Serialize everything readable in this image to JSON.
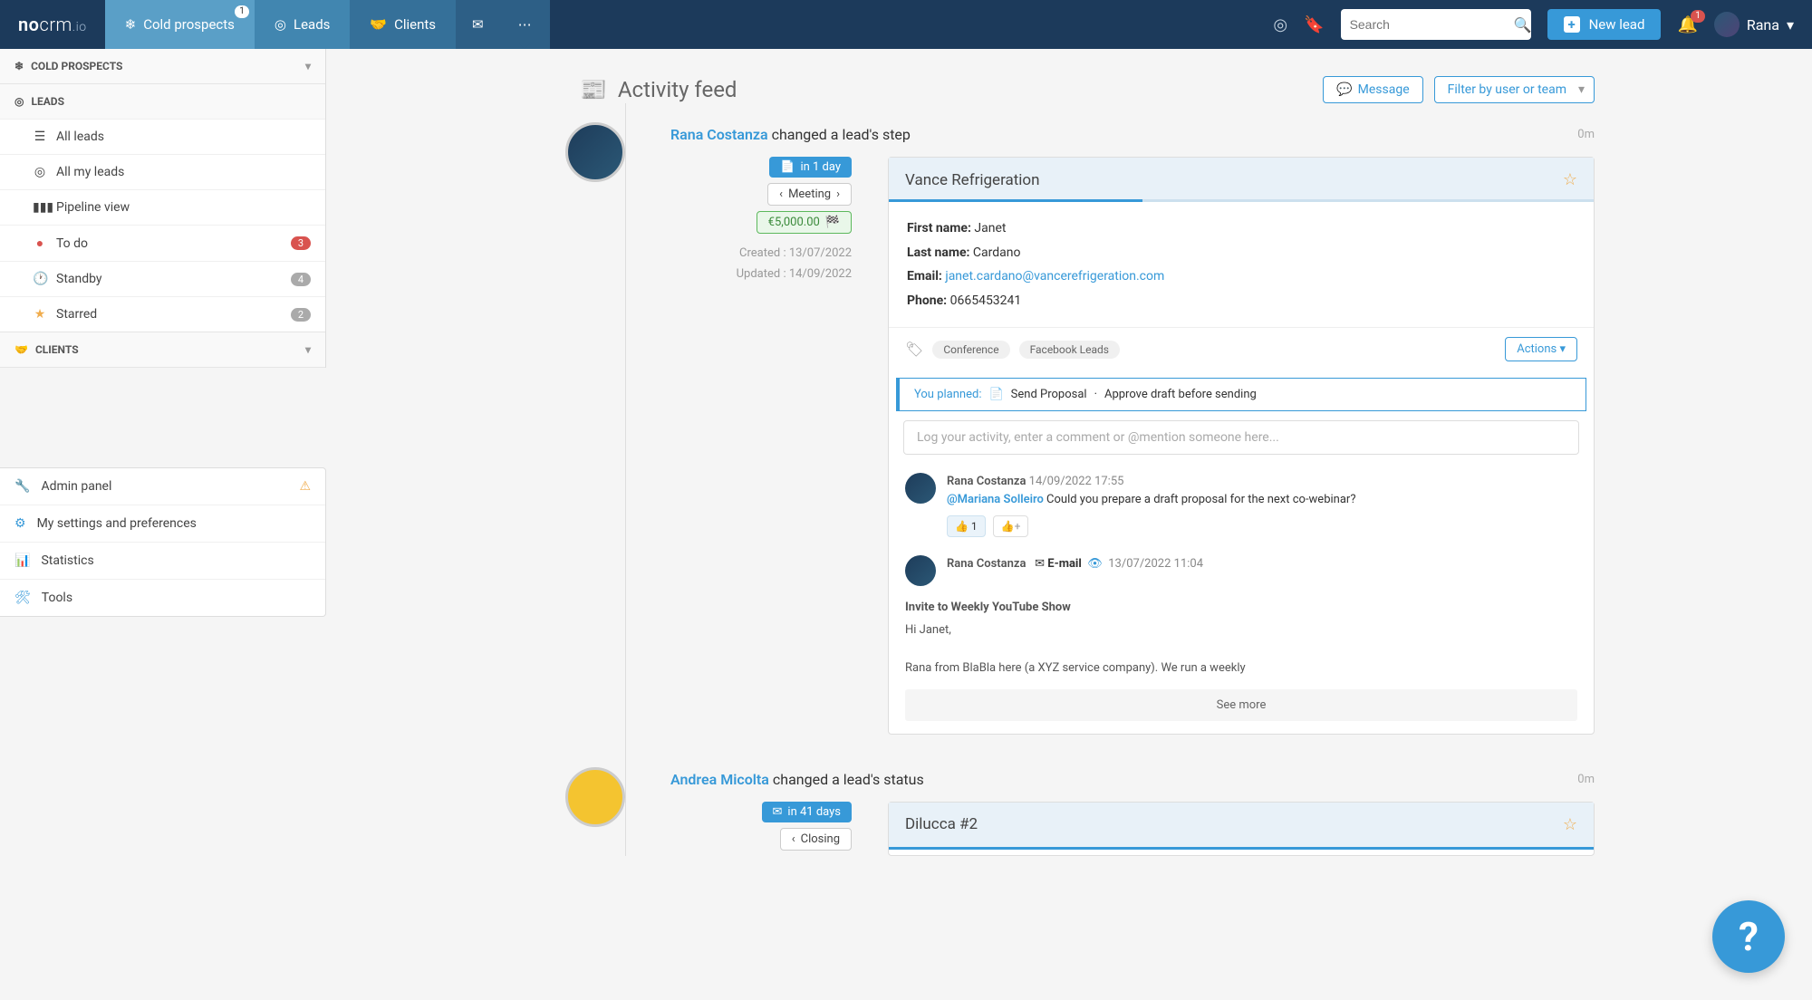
{
  "topbar": {
    "logo_no": "no",
    "logo_crm": "crm",
    "logo_io": ".io",
    "tabs": {
      "cold": "Cold prospects",
      "cold_badge": "1",
      "leads": "Leads",
      "clients": "Clients"
    },
    "search_placeholder": "Search",
    "new_lead": "New lead",
    "bell_badge": "1",
    "user_name": "Rana"
  },
  "sidebar": {
    "sections": {
      "cold_prospects": "COLD PROSPECTS",
      "leads": "LEADS",
      "clients": "CLIENTS"
    },
    "items": {
      "all_leads": "All leads",
      "all_my_leads": "All my leads",
      "pipeline": "Pipeline view",
      "todo": "To do",
      "todo_badge": "3",
      "standby": "Standby",
      "standby_badge": "4",
      "starred": "Starred",
      "starred_badge": "2"
    }
  },
  "secondary": {
    "admin": "Admin panel",
    "settings": "My settings and preferences",
    "statistics": "Statistics",
    "tools": "Tools"
  },
  "feed": {
    "title": "Activity feed",
    "message_btn": "Message",
    "filter_btn": "Filter by user or team"
  },
  "item1": {
    "user": "Rana Costanza",
    "action": " changed a lead's step",
    "time": "0m",
    "due": "in 1 day",
    "stage": "Meeting",
    "amount": "€5,000.00",
    "created": "Created : 13/07/2022",
    "updated": "Updated : 14/09/2022",
    "lead_title": "Vance Refrigeration",
    "first_label": "First name:",
    "first_val": " Janet",
    "last_label": "Last name:",
    "last_val": " Cardano",
    "email_label": "Email:",
    "email_val": "janet.cardano@vancerefrigeration.com",
    "phone_label": "Phone:",
    "phone_val": " 0665453241",
    "tag1": "Conference",
    "tag2": "Facebook Leads",
    "actions": "Actions",
    "planned_label": "You planned:",
    "planned1": "Send Proposal",
    "planned_sep": "·",
    "planned2": "Approve draft before sending",
    "comment_placeholder": "Log your activity, enter a comment or @mention someone here...",
    "c1_author": "Rana Costanza",
    "c1_ts": "14/09/2022 17:55",
    "c1_mention": "@Mariana Solleiro",
    "c1_text": " Could you prepare a draft proposal for the next co-webinar?",
    "c1_react": "👍 1",
    "c1_add": "👍+",
    "c2_author": "Rana Costanza",
    "c2_channel": "E-mail",
    "c2_ts": "13/07/2022 11:04",
    "c2_title": "Invite to Weekly YouTube Show",
    "c2_greet": "Hi Janet,",
    "c2_body": "Rana from BlaBla here (a XYZ service company). We run a weekly",
    "see_more": "See more"
  },
  "item2": {
    "user": "Andrea Micolta",
    "action": " changed a lead's status",
    "time": "0m",
    "due": "in 41 days",
    "stage": "Closing",
    "lead_title": "Dilucca #2"
  },
  "help": "?"
}
